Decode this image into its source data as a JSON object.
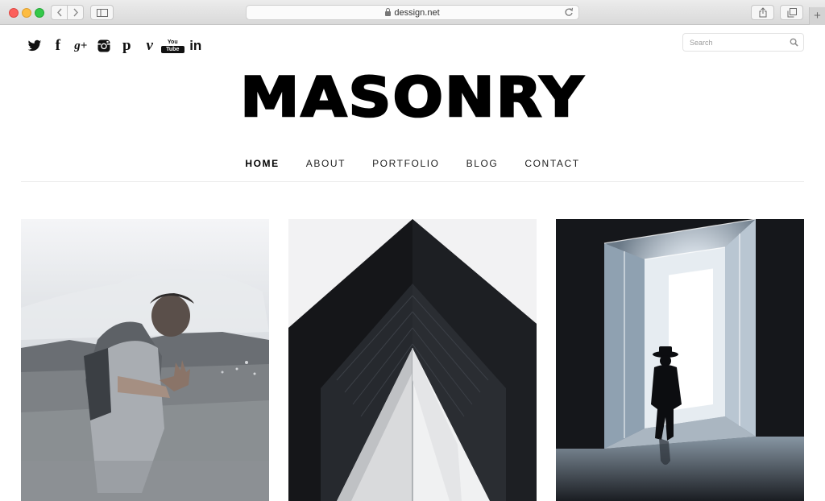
{
  "browser": {
    "url": "dessign.net",
    "new_tab_label": "+"
  },
  "social": {
    "facebook": "f",
    "google_plus": "g+",
    "pinterest": "p",
    "vimeo": "v",
    "youtube_top": "You",
    "youtube_bottom": "Tube",
    "linkedin": "in"
  },
  "search": {
    "placeholder": "Search"
  },
  "site": {
    "logo": "MASONRY"
  },
  "nav": {
    "items": [
      "HOME",
      "ABOUT",
      "PORTFOLIO",
      "BLOG",
      "CONTACT"
    ],
    "active": "HOME"
  },
  "colors": {
    "accent": "#000000",
    "divider": "#ececec"
  },
  "posts": [
    {
      "image": "man-reaching-toward-camera-photo"
    },
    {
      "image": "building-corner-looking-up-photo"
    },
    {
      "image": "silhouette-in-light-corridor-photo"
    }
  ]
}
